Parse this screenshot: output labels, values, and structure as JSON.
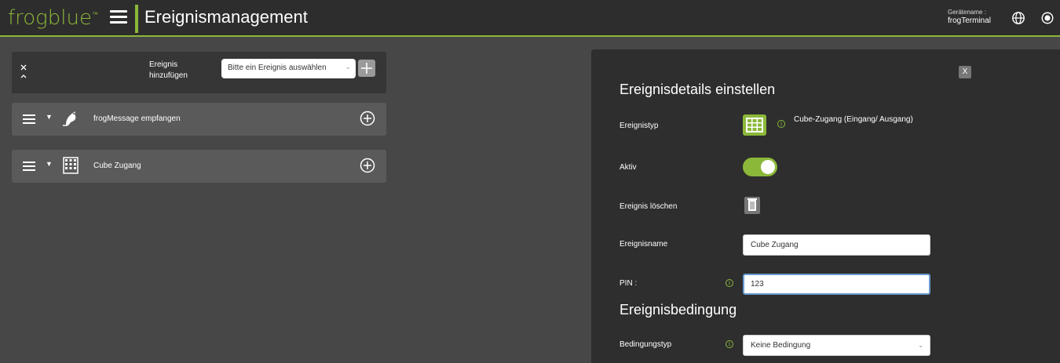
{
  "header": {
    "logo": "frogblue",
    "logo_tm": "™",
    "title": "Ereignismanagement",
    "device_label": "Gerätename :",
    "device_value": "frogTerminal",
    "icons": [
      "menu-icon",
      "globe-icon",
      "power-icon"
    ],
    "accent_color": "#8cb83a"
  },
  "add_event": {
    "label_line1": "Ereignis",
    "label_line2": "hinzufügen",
    "select_value": "Bitte ein Ereignis auswählen"
  },
  "events": [
    {
      "label": "frogMessage empfangen",
      "icon": "frog-message-icon"
    },
    {
      "label": "Cube Zugang",
      "icon": "cube-access-icon"
    }
  ],
  "details": {
    "close_label": "X",
    "section_title": "Ereignisdetails einstellen",
    "type_label": "Ereignistyp",
    "type_value": "Cube-Zugang (Eingang/ Ausgang)",
    "active_label": "Aktiv",
    "active_value": true,
    "delete_label": "Ereignis löschen",
    "name_label": "Ereignisname",
    "name_value": "Cube Zugang",
    "pin_label": "PIN :",
    "pin_value": "123",
    "condition_title": "Ereignisbedingung",
    "condition_type_label": "Bedingungstyp",
    "condition_type_value": "Keine Bedingung"
  }
}
